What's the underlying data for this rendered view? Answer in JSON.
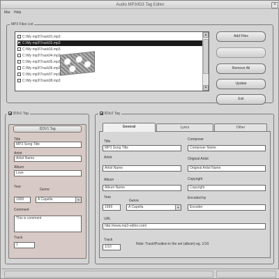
{
  "window": {
    "title": "Audio MP3/ID3 Tag Editor"
  },
  "menu": [
    "Mar",
    "Help"
  ],
  "mp3_group": {
    "legend": "MP3 Files List",
    "files": [
      {
        "name": "C:\\My mp3\\Track01.mp3",
        "checked": false,
        "selected": false
      },
      {
        "name": "C:\\My mp3\\Track02.mp3",
        "checked": true,
        "selected": true
      },
      {
        "name": "C:\\My mp3\\Track03.mp3",
        "checked": false,
        "selected": false
      },
      {
        "name": "C:\\My mp3\\Track04.mp3",
        "checked": false,
        "selected": false
      },
      {
        "name": "C:\\My mp3\\Track05.mp3",
        "checked": false,
        "selected": false
      },
      {
        "name": "C:\\My mp3\\Track06.mp3",
        "checked": false,
        "selected": false
      },
      {
        "name": "C:\\My mp3\\Track07.mp3",
        "checked": false,
        "selected": false
      },
      {
        "name": "C:\\My mp3\\Track08.mp3",
        "checked": false,
        "selected": false
      }
    ]
  },
  "buttons": {
    "add_files": "Add Files",
    "blank": "",
    "remove_all": "Remove All",
    "update": "Update",
    "exit": "Exit"
  },
  "id3v1": {
    "legend": "ID3v1 Tag",
    "header": "ID3V1 Tag",
    "title_label": "Title",
    "title_value": "MP3 Song Title",
    "artist_label": "Artist",
    "artist_value": "Artist Name",
    "album_label": "Album",
    "album_value": "Love",
    "year_label": "Year",
    "year_value": "1999",
    "genre_label": "Genre",
    "genre_value": "A Capella",
    "comment_label": "Comment",
    "comment_value": "This is comment",
    "track_label": "Track",
    "track_value": "1"
  },
  "id3v2": {
    "legend": "ID3v2 Tag",
    "tabs": [
      "General",
      "Lyrics",
      "Other"
    ],
    "title_label": "Title",
    "title_value": "MP3 Song Title",
    "composer_label": "Composer",
    "composer_value": "Composer Name",
    "artist_label": "Artist",
    "artist_value": "Artist Name",
    "orig_artist_label": "Original Artist",
    "orig_artist_value": "Original Artist Name",
    "album_label": "Album",
    "album_value": "Album Name",
    "copyright_label": "Copyright",
    "copyright_value": "Copyright",
    "year_label": "Year",
    "year_value": "1999",
    "genre_label": "Genre",
    "genre_value": "A Capella",
    "encoded_label": "Encoded by",
    "encoded_value": "Encoder",
    "url_label": "URL",
    "url_value": "http://www.mp3-editor.com/",
    "track_label": "Track",
    "track_value": "1/10",
    "track_note": "Note: Track/Position in the set (album) eg. 1/10"
  }
}
